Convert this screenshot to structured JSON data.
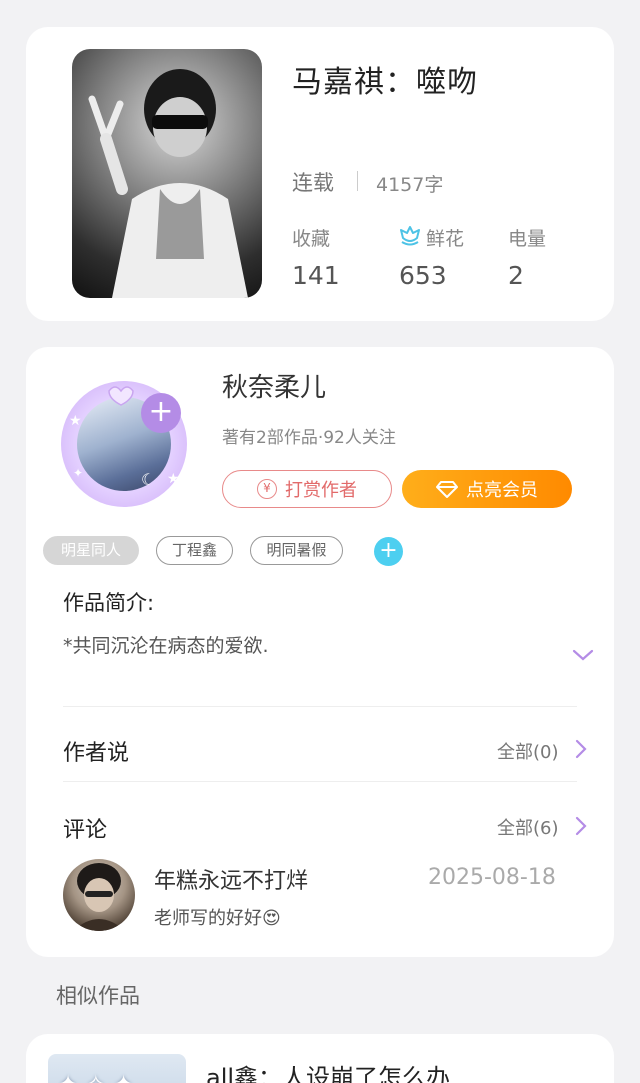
{
  "book": {
    "title": "马嘉祺：噬吻",
    "status": "连载",
    "word_count": "4157字",
    "stats": [
      {
        "label": "收藏",
        "value": "141"
      },
      {
        "label": "鲜花",
        "value": "653"
      },
      {
        "label": "电量",
        "value": "2"
      }
    ]
  },
  "author": {
    "name": "秋奈柔儿",
    "meta": "著有2部作品·92人关注",
    "tip_button": "打赏作者",
    "vip_button": "点亮会员",
    "yen_symbol": "¥",
    "plus_symbol": "+"
  },
  "tags": [
    {
      "label": "明星同人",
      "active": true
    },
    {
      "label": "丁程鑫",
      "active": false
    },
    {
      "label": "明同暑假",
      "active": false
    }
  ],
  "intro": {
    "label": "作品简介:",
    "text": "*共同沉沦在病态的爱欲."
  },
  "author_says": {
    "label": "作者说",
    "link": "全部(0)"
  },
  "comments": {
    "label": "评论",
    "link": "全部(6)",
    "items": [
      {
        "name": "年糕永远不打烊",
        "date": "2025-08-18",
        "text": "老师写的好好😍"
      }
    ]
  },
  "similar": {
    "section_title": "相似作品",
    "items": [
      {
        "title": "all鑫：人设崩了怎么办"
      }
    ]
  },
  "colors": {
    "accent_purple": "#b48ce6",
    "vip_orange": "#ff8a00",
    "tip_red": "#e26a6a",
    "tag_add_blue": "#4dcff0"
  }
}
